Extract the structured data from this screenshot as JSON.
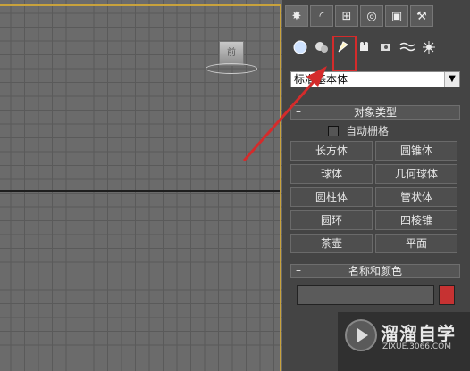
{
  "viewport": {
    "cube_label": "前"
  },
  "command_panel": {
    "tabs": [
      "create-tab",
      "modify-tab",
      "hierarchy-tab",
      "motion-tab",
      "display-tab",
      "utilities-tab"
    ],
    "categories": [
      "geometry-icon",
      "shapes-icon",
      "lights-icon",
      "cameras-icon",
      "helpers-icon",
      "spacewarps-icon",
      "systems-icon"
    ],
    "dropdown": {
      "selected": "标准基本体"
    },
    "object_type": {
      "header": "对象类型",
      "collapse": "–",
      "autogrid_label": "自动栅格",
      "buttons": [
        "长方体",
        "圆锥体",
        "球体",
        "几何球体",
        "圆柱体",
        "管状体",
        "圆环",
        "四棱锥",
        "茶壶",
        "平面"
      ]
    },
    "name_color": {
      "header": "名称和颜色",
      "collapse": "–",
      "name_value": "",
      "color": "#c63232"
    }
  },
  "watermark": {
    "title": "溜溜自学",
    "url": "ZIXUE.3066.COM"
  },
  "colors": {
    "highlight": "#d42b2b",
    "viewport_border": "#c8a23c"
  }
}
